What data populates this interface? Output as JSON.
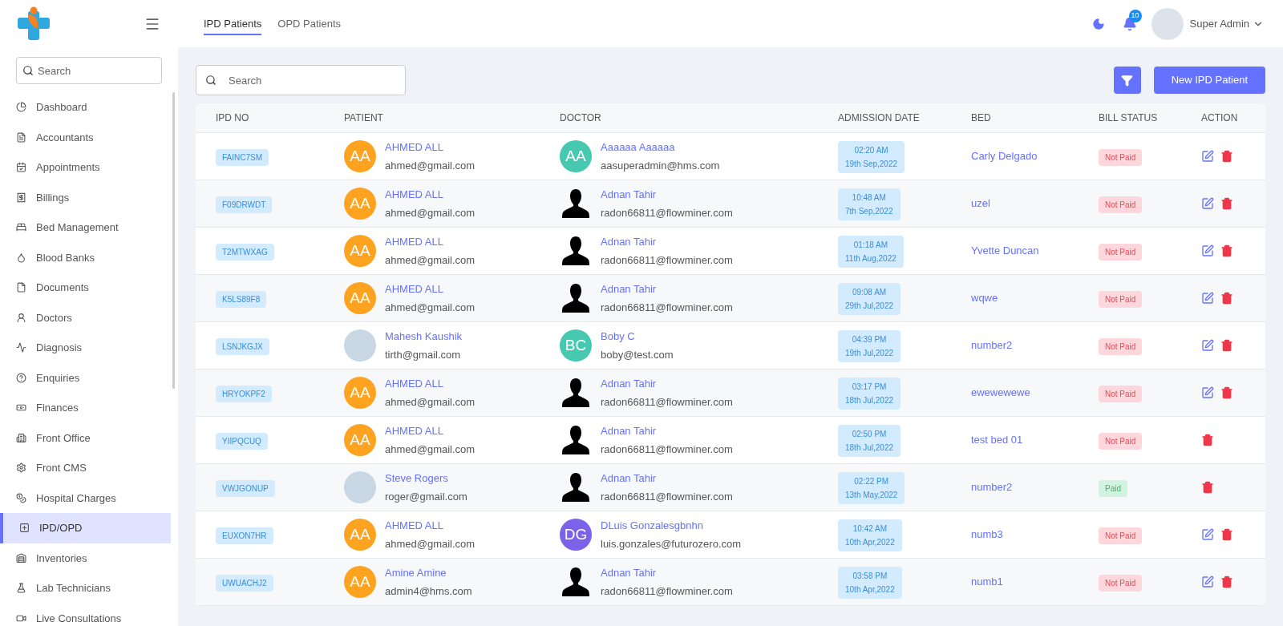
{
  "header": {
    "tabs": [
      {
        "label": "IPD Patients",
        "selected": true
      },
      {
        "label": "OPD Patients",
        "selected": false
      }
    ],
    "notifications": "10",
    "user": "Super Admin"
  },
  "sidebar": {
    "search": {
      "placeholder": "Search"
    },
    "items": [
      {
        "label": "Dashboard",
        "selected": false
      },
      {
        "label": "Accountants",
        "selected": false
      },
      {
        "label": "Appointments",
        "selected": false
      },
      {
        "label": "Billings",
        "selected": false
      },
      {
        "label": "Bed Management",
        "selected": false
      },
      {
        "label": "Blood Banks",
        "selected": false
      },
      {
        "label": "Documents",
        "selected": false
      },
      {
        "label": "Doctors",
        "selected": false
      },
      {
        "label": "Diagnosis",
        "selected": false
      },
      {
        "label": "Enquiries",
        "selected": false
      },
      {
        "label": "Finances",
        "selected": false
      },
      {
        "label": "Front Office",
        "selected": false
      },
      {
        "label": "Front CMS",
        "selected": false
      },
      {
        "label": "Hospital Charges",
        "selected": false
      },
      {
        "label": "IPD/OPD",
        "selected": true
      },
      {
        "label": "Inventories",
        "selected": false
      },
      {
        "label": "Lab Technicians",
        "selected": false
      },
      {
        "label": "Live Consultations",
        "selected": false
      }
    ]
  },
  "search": {
    "placeholder": "Search"
  },
  "new_button": "New IPD Patient",
  "table": {
    "columns": [
      "IPD NO",
      "PATIENT",
      "DOCTOR",
      "ADMISSION DATE",
      "BED",
      "BILL STATUS",
      "ACTION"
    ],
    "rows": [
      {
        "ipd_no": "FAINC7SM",
        "patient": {
          "avatar": {
            "kind": "initials",
            "text": "AA",
            "color": "#fea31f"
          },
          "name": "AHMED ALL",
          "email": "ahmed@gmail.com"
        },
        "doctor": {
          "avatar": {
            "kind": "initials",
            "text": "AA",
            "color": "#46c9b0"
          },
          "name": "Aaaaaa Aaaaaa",
          "email": "aasuperadmin@hms.com"
        },
        "time": "02:20 AM",
        "date": "19th Sep,2022",
        "bed": "Carly Delgado",
        "bill": {
          "kind": "not_paid",
          "label": "Not Paid"
        },
        "editable": true
      },
      {
        "ipd_no": "F09DRWDT",
        "patient": {
          "avatar": {
            "kind": "initials",
            "text": "AA",
            "color": "#fea31f"
          },
          "name": "AHMED ALL",
          "email": "ahmed@gmail.com"
        },
        "doctor": {
          "avatar": {
            "kind": "silhouette"
          },
          "name": "Adnan Tahir",
          "email": "radon66811@flowminer.com"
        },
        "time": "10:48 AM",
        "date": "7th Sep,2022",
        "bed": "uzel",
        "bill": {
          "kind": "not_paid",
          "label": "Not Paid"
        },
        "editable": true
      },
      {
        "ipd_no": "T2MTWXAG",
        "patient": {
          "avatar": {
            "kind": "initials",
            "text": "AA",
            "color": "#fea31f"
          },
          "name": "AHMED ALL",
          "email": "ahmed@gmail.com"
        },
        "doctor": {
          "avatar": {
            "kind": "silhouette"
          },
          "name": "Adnan Tahir",
          "email": "radon66811@flowminer.com"
        },
        "time": "01:18 AM",
        "date": "11th Aug,2022",
        "bed": "Yvette Duncan",
        "bill": {
          "kind": "not_paid",
          "label": "Not Paid"
        },
        "editable": true
      },
      {
        "ipd_no": "K5LS89F8",
        "patient": {
          "avatar": {
            "kind": "initials",
            "text": "AA",
            "color": "#fea31f"
          },
          "name": "AHMED ALL",
          "email": "ahmed@gmail.com"
        },
        "doctor": {
          "avatar": {
            "kind": "silhouette"
          },
          "name": "Adnan Tahir",
          "email": "radon66811@flowminer.com"
        },
        "time": "09:08 AM",
        "date": "29th Jul,2022",
        "bed": "wqwe",
        "bill": {
          "kind": "not_paid",
          "label": "Not Paid"
        },
        "editable": true
      },
      {
        "ipd_no": "LSNJKGJX",
        "patient": {
          "avatar": {
            "kind": "photo"
          },
          "name": "Mahesh Kaushik",
          "email": "tirth@gmail.com"
        },
        "doctor": {
          "avatar": {
            "kind": "initials",
            "text": "BC",
            "color": "#46c9b0"
          },
          "name": "Boby C",
          "email": "boby@test.com"
        },
        "time": "04:39 PM",
        "date": "19th Jul,2022",
        "bed": "number2",
        "bill": {
          "kind": "not_paid",
          "label": "Not Paid"
        },
        "editable": true
      },
      {
        "ipd_no": "HRYOKPF2",
        "patient": {
          "avatar": {
            "kind": "initials",
            "text": "AA",
            "color": "#fea31f"
          },
          "name": "AHMED ALL",
          "email": "ahmed@gmail.com"
        },
        "doctor": {
          "avatar": {
            "kind": "silhouette"
          },
          "name": "Adnan Tahir",
          "email": "radon66811@flowminer.com"
        },
        "time": "03:17 PM",
        "date": "18th Jul,2022",
        "bed": "ewewewewe",
        "bill": {
          "kind": "not_paid",
          "label": "Not Paid"
        },
        "editable": true
      },
      {
        "ipd_no": "YIIPQCUQ",
        "patient": {
          "avatar": {
            "kind": "initials",
            "text": "AA",
            "color": "#fea31f"
          },
          "name": "AHMED ALL",
          "email": "ahmed@gmail.com"
        },
        "doctor": {
          "avatar": {
            "kind": "silhouette"
          },
          "name": "Adnan Tahir",
          "email": "radon66811@flowminer.com"
        },
        "time": "02:50 PM",
        "date": "18th Jul,2022",
        "bed": "test bed 01",
        "bill": {
          "kind": "not_paid",
          "label": "Not Paid"
        },
        "editable": false
      },
      {
        "ipd_no": "VWJGONUP",
        "patient": {
          "avatar": {
            "kind": "photo"
          },
          "name": "Steve Rogers",
          "email": "roger@gmail.com"
        },
        "doctor": {
          "avatar": {
            "kind": "silhouette"
          },
          "name": "Adnan Tahir",
          "email": "radon66811@flowminer.com"
        },
        "time": "02:22 PM",
        "date": "13th May,2022",
        "bed": "number2",
        "bill": {
          "kind": "paid",
          "label": "Paid"
        },
        "editable": false
      },
      {
        "ipd_no": "EUXON7HR",
        "patient": {
          "avatar": {
            "kind": "initials",
            "text": "AA",
            "color": "#fea31f"
          },
          "name": "AHMED ALL",
          "email": "ahmed@gmail.com"
        },
        "doctor": {
          "avatar": {
            "kind": "initials",
            "text": "DG",
            "color": "#7a63e8"
          },
          "name": "DLuis Gonzalesgbnhn",
          "email": "luis.gonzales@futurozero.com"
        },
        "time": "10:42 AM",
        "date": "10th Apr,2022",
        "bed": "numb3",
        "bill": {
          "kind": "not_paid",
          "label": "Not Paid"
        },
        "editable": true
      },
      {
        "ipd_no": "UWUACHJ2",
        "patient": {
          "avatar": {
            "kind": "initials",
            "text": "AA",
            "color": "#fea31f"
          },
          "name": "Amine Amine",
          "email": "admin4@hms.com"
        },
        "doctor": {
          "avatar": {
            "kind": "silhouette"
          },
          "name": "Adnan Tahir",
          "email": "radon66811@flowminer.com"
        },
        "time": "03:58 PM",
        "date": "10th Apr,2022",
        "bed": "numb1",
        "bill": {
          "kind": "not_paid",
          "label": "Not Paid"
        },
        "editable": true
      }
    ]
  }
}
